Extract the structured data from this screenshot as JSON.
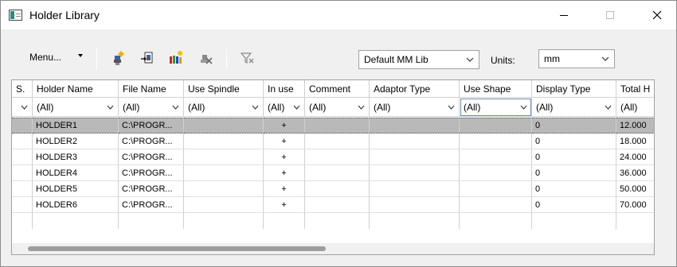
{
  "window": {
    "title": "Holder Library"
  },
  "toolbar": {
    "menu_label": "Menu...",
    "icons": [
      "new-holder-icon",
      "import-holder-icon",
      "color-palette-icon",
      "delete-holder-icon",
      "clear-filter-icon"
    ],
    "library_select": "Default MM Lib",
    "units_label": "Units:",
    "units_select": "mm"
  },
  "grid": {
    "columns": [
      "S.",
      "Holder Name",
      "File Name",
      "Use Spindle",
      "In use",
      "Comment",
      "Adaptor Type",
      "Use Shape",
      "Display Type",
      "Total H"
    ],
    "filter_value": "(All)",
    "rows": [
      {
        "name": "HOLDER1",
        "file": "C:\\PROGR...",
        "in_use": "+",
        "display": "0",
        "total": "12.000"
      },
      {
        "name": "HOLDER2",
        "file": "C:\\PROGR...",
        "in_use": "+",
        "display": "0",
        "total": "18.000"
      },
      {
        "name": "HOLDER3",
        "file": "C:\\PROGR...",
        "in_use": "+",
        "display": "0",
        "total": "24.000"
      },
      {
        "name": "HOLDER4",
        "file": "C:\\PROGR...",
        "in_use": "+",
        "display": "0",
        "total": "36.000"
      },
      {
        "name": "HOLDER5",
        "file": "C:\\PROGR...",
        "in_use": "+",
        "display": "0",
        "total": "50.000"
      },
      {
        "name": "HOLDER6",
        "file": "C:\\PROGR...",
        "in_use": "+",
        "display": "0",
        "total": "70.000"
      }
    ]
  }
}
